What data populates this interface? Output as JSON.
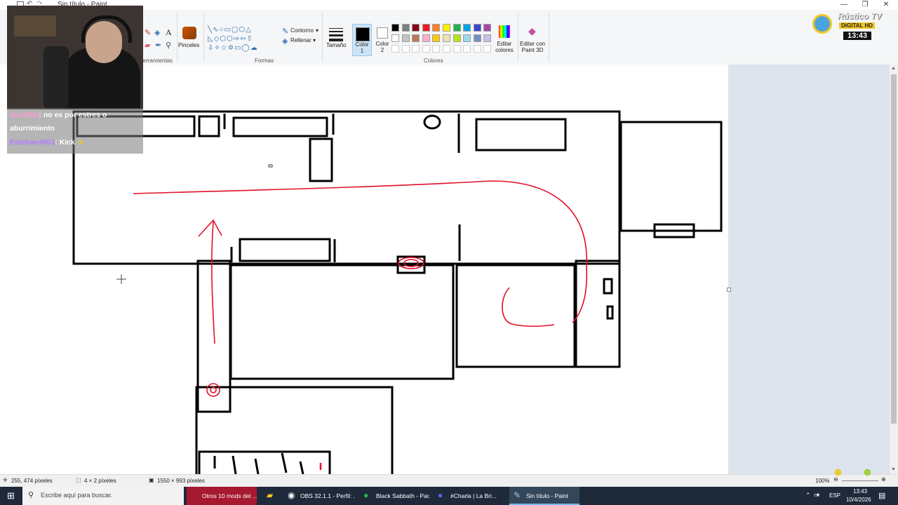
{
  "window": {
    "title": "Sin título - Paint",
    "controls": [
      "minimize",
      "maximize",
      "close"
    ]
  },
  "ribbon": {
    "groups": {
      "tools_label": "Herramientas",
      "brushes_label": "Pinceles",
      "shapes_label": "Formas",
      "outline_label": "Contorno",
      "fill_label": "Rellenar",
      "size_label": "Tamaño",
      "color1_label": "Color 1",
      "color2_label": "Color 2",
      "colors_label": "Colores",
      "edit_colors_label": "Editar colores",
      "paint3d_label": "Editar con Paint 3D"
    },
    "palette_row1": [
      "#000000",
      "#7f7f7f",
      "#880015",
      "#ed1c24",
      "#ff7f27",
      "#fff200",
      "#22b14c",
      "#00a2e8",
      "#3f48cc",
      "#a349a4"
    ],
    "palette_row2": [
      "#ffffff",
      "#c3c3c3",
      "#b97a57",
      "#ffaec9",
      "#ffc90e",
      "#efe4b0",
      "#b5e61d",
      "#99d9ea",
      "#7092be",
      "#c8bfe7"
    ],
    "color1": "#000000",
    "color2": "#ffffff"
  },
  "overlay": {
    "chat": [
      {
        "user": "HushSG",
        "user_color": "#ff9ad2",
        "message": ": no es por estres o"
      },
      {
        "user": "",
        "user_color": "#ffffff",
        "message": "aburrimiento"
      },
      {
        "user": "Esteban4801",
        "user_color": "#b07cff",
        "message": ": Kick"
      }
    ],
    "logo": {
      "name": "Rústico TV",
      "sub": "DIGITAL HD",
      "time": "13:43"
    }
  },
  "statusbar": {
    "cursor_pos": "255, 474 píxeles",
    "selection_size": "4 × 2 píxeles",
    "canvas_size": "1550 × 993 píxeles",
    "zoom": "100%"
  },
  "taskbar": {
    "search_placeholder": "Escribe aquí para buscar.",
    "tasks": [
      {
        "label": "Otros 10 mods del ..."
      },
      {
        "label": "OBS 32.1.1 - Perfil: ..."
      },
      {
        "label": "Black Sabbath - Par..."
      },
      {
        "label": "#Charla | La Bri..."
      },
      {
        "label": "Sin título - Paint"
      }
    ],
    "lang": "ESP",
    "time": "13:43",
    "date": "10/4/2026"
  }
}
